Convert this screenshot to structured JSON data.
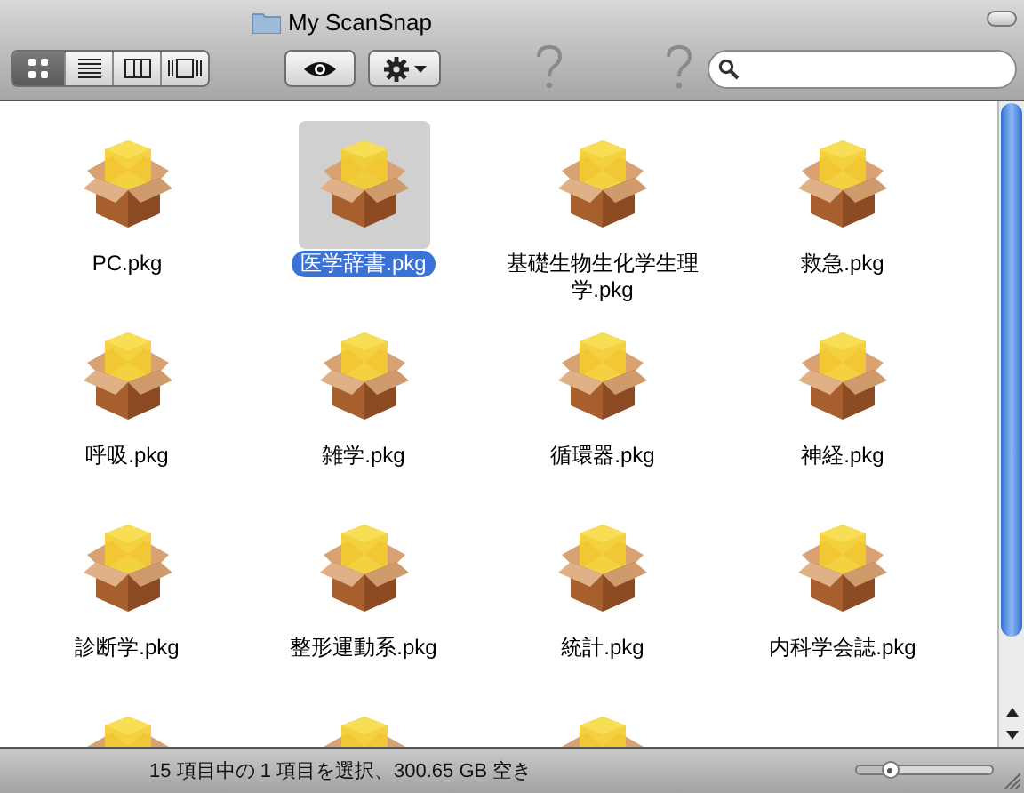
{
  "window": {
    "title": "My ScanSnap"
  },
  "view_buttons": [
    {
      "kind": "icons",
      "selected": true
    },
    {
      "kind": "list",
      "selected": false
    },
    {
      "kind": "columns",
      "selected": false
    },
    {
      "kind": "coverflow",
      "selected": false
    }
  ],
  "toolbar_items": [
    {
      "kind": "quicklook"
    },
    {
      "kind": "action"
    },
    {
      "kind": "unknown"
    },
    {
      "kind": "unknown"
    }
  ],
  "items": [
    {
      "name": "PC.pkg",
      "selected": false
    },
    {
      "name": "医学辞書.pkg",
      "selected": true
    },
    {
      "name": "基礎生物生化学生理学.pkg",
      "selected": false
    },
    {
      "name": "救急.pkg",
      "selected": false
    },
    {
      "name": "呼吸.pkg",
      "selected": false
    },
    {
      "name": "雑学.pkg",
      "selected": false
    },
    {
      "name": "循環器.pkg",
      "selected": false
    },
    {
      "name": "神経.pkg",
      "selected": false
    },
    {
      "name": "診断学.pkg",
      "selected": false
    },
    {
      "name": "整形運動系.pkg",
      "selected": false
    },
    {
      "name": "統計.pkg",
      "selected": false
    },
    {
      "name": "内科学会誌.pkg",
      "selected": false
    }
  ],
  "partial_items": [
    {
      "kind": "package"
    },
    {
      "kind": "package"
    },
    {
      "kind": "package"
    }
  ],
  "status_bar": {
    "text": "15 項目中の 1 項目を選択、300.65 GB 空き",
    "icon_size": {
      "level": 0.25
    }
  }
}
